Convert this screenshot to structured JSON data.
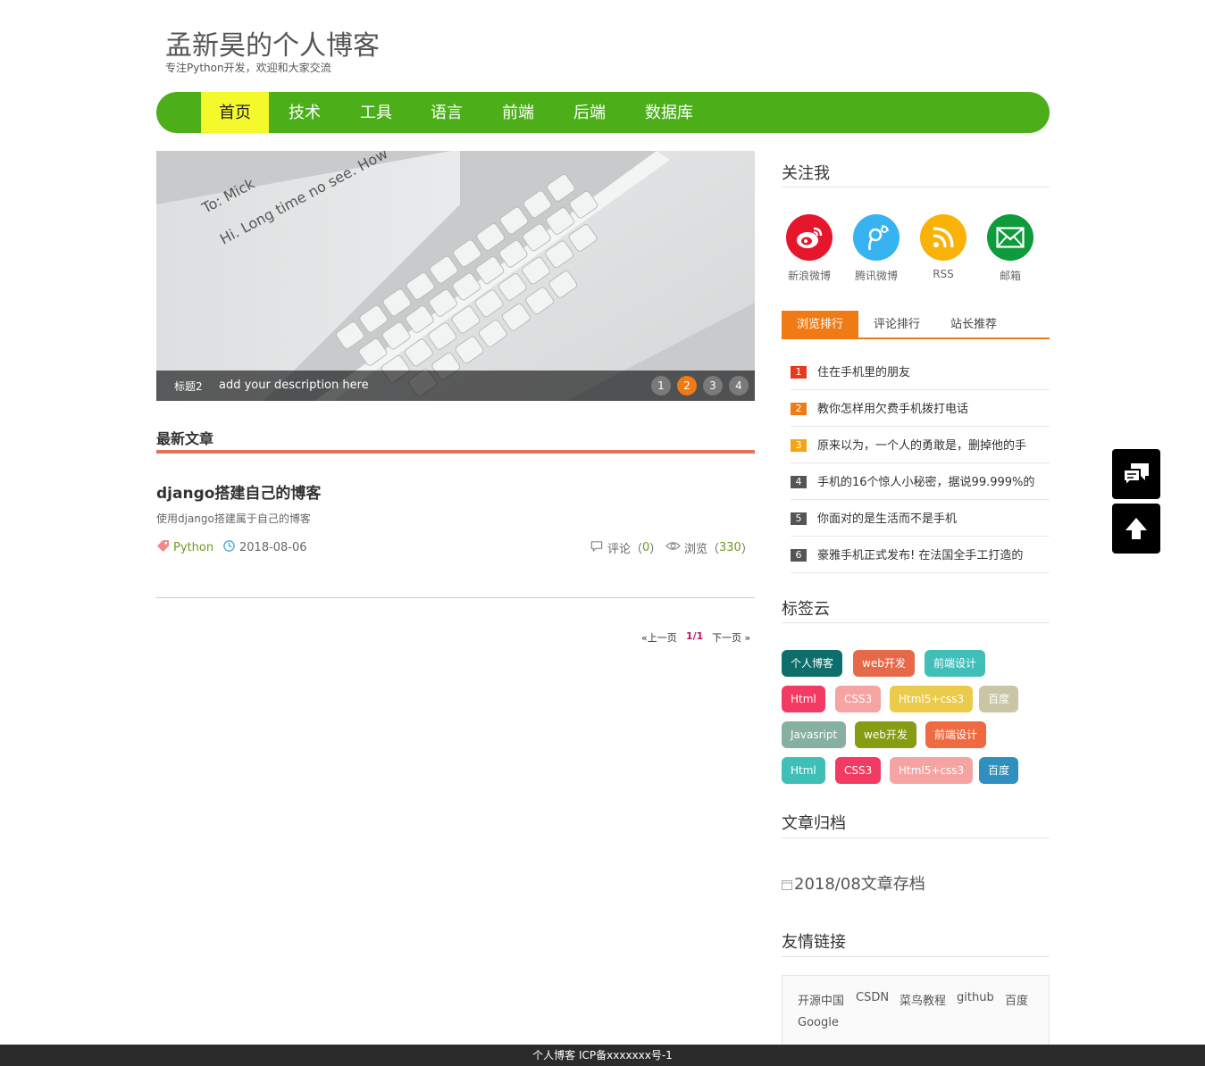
{
  "header": {
    "title": "孟新昊的个人博客",
    "subtitle": "专注Python开发，欢迎和大家交流"
  },
  "nav": {
    "items": [
      "首页",
      "技术",
      "工具",
      "语言",
      "前端",
      "后端",
      "数据库"
    ],
    "active_index": 0
  },
  "slider": {
    "title": "标题2",
    "description": "add your description here",
    "dots": [
      "1",
      "2",
      "3",
      "4"
    ],
    "active_dot": 1,
    "image_text": [
      "To: Mick",
      "Hi. Long time no see. How"
    ]
  },
  "latest": {
    "heading": "最新文章",
    "post": {
      "title": "django搭建自己的博客",
      "summary": "使用django搭建属于自己的博客",
      "tag": "Python",
      "date": "2018-08-06",
      "comments_label": "评论（",
      "comments_count": "0",
      "views_label": "浏览（",
      "views_count": "330",
      "close_paren": "）"
    }
  },
  "pager": {
    "prev": "«上一页",
    "current": "1/1",
    "next": "下一页 »"
  },
  "follow": {
    "heading": "关注我",
    "items": [
      {
        "label": "新浪微博",
        "icon": "weibo-icon",
        "color": "#e6162d"
      },
      {
        "label": "腾讯微博",
        "icon": "tencent-weibo-icon",
        "color": "#36b3f0"
      },
      {
        "label": "RSS",
        "icon": "rss-icon",
        "color": "#f9b208"
      },
      {
        "label": "邮箱",
        "icon": "mail-icon",
        "color": "#0d9b3b"
      }
    ]
  },
  "rank_tabs": {
    "tabs": [
      "浏览排行",
      "评论排行",
      "站长推荐"
    ],
    "active_index": 0,
    "items": [
      {
        "num": "1",
        "text": "住在手机里的朋友",
        "color": "#e63a1e"
      },
      {
        "num": "2",
        "text": "教你怎样用欠费手机拨打电话",
        "color": "#f07b14"
      },
      {
        "num": "3",
        "text": "原来以为，一个人的勇敢是，删掉他的手",
        "color": "#f5a514"
      },
      {
        "num": "4",
        "text": "手机的16个惊人小秘密，据说99.999%的",
        "color": "#555555"
      },
      {
        "num": "5",
        "text": "你面对的是生活而不是手机",
        "color": "#555555"
      },
      {
        "num": "6",
        "text": "豪雅手机正式发布! 在法国全手工打造的",
        "color": "#555555"
      }
    ]
  },
  "tag_cloud": {
    "heading": "标签云",
    "tags": [
      {
        "label": "个人博客",
        "color": "#0e6e6b"
      },
      {
        "label": "web开发",
        "color": "#e8694a"
      },
      {
        "label": "前端设计",
        "color": "#3fbfb7"
      },
      {
        "label": "Html",
        "color": "#f33a63"
      },
      {
        "label": "CSS3",
        "color": "#f5a3a3"
      },
      {
        "label": "Html5+css3",
        "color": "#eacb4c"
      },
      {
        "label": "百度",
        "color": "#c9c5a5"
      },
      {
        "label": "Javasript",
        "color": "#86b0a0"
      },
      {
        "label": "web开发",
        "color": "#869c12"
      },
      {
        "label": "前端设计",
        "color": "#ee6a40"
      },
      {
        "label": "Html",
        "color": "#3fbfb7"
      },
      {
        "label": "CSS3",
        "color": "#f33a63"
      },
      {
        "label": "Html5+css3",
        "color": "#f5a3a3"
      },
      {
        "label": "百度",
        "color": "#2f8fbf"
      }
    ]
  },
  "archive": {
    "heading": "文章归档",
    "items": [
      "2018/08文章存档"
    ]
  },
  "friend_links": {
    "heading": "友情链接",
    "links": [
      "开源中国",
      "CSDN",
      "菜鸟教程",
      "github",
      "百度",
      "Google"
    ]
  },
  "footer": {
    "text": "个人博客 ICP备xxxxxxx号-1"
  }
}
